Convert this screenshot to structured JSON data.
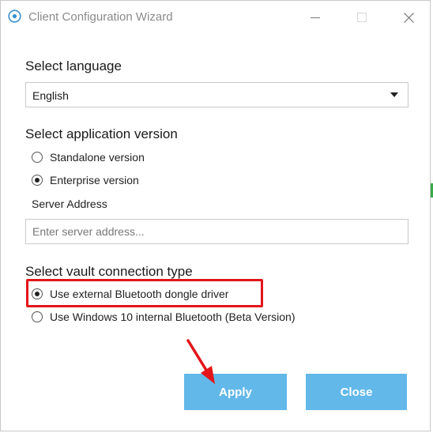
{
  "window": {
    "title": "Client Configuration Wizard"
  },
  "language": {
    "label": "Select language",
    "selected": "English"
  },
  "version": {
    "label": "Select application version",
    "options": [
      {
        "label": "Standalone version",
        "checked": false
      },
      {
        "label": "Enterprise version",
        "checked": true
      }
    ]
  },
  "server": {
    "label": "Server Address",
    "value": "",
    "placeholder": "Enter server address..."
  },
  "vault": {
    "label": "Select vault connection type",
    "options": [
      {
        "label": "Use external Bluetooth dongle driver",
        "checked": true
      },
      {
        "label": "Use Windows 10 internal Bluetooth (Beta Version)",
        "checked": false
      }
    ]
  },
  "buttons": {
    "apply": "Apply",
    "close": "Close"
  },
  "colors": {
    "button": "#62b8e8",
    "annotation": "#e3151a",
    "app_icon": "#3a8fd0"
  },
  "icons": {
    "app": "circle-dot-icon",
    "minimize": "minimize-icon",
    "maximize": "maximize-icon",
    "close": "close-icon",
    "dropdown": "caret-down-icon",
    "annotation_arrow": "red-arrow-icon"
  }
}
